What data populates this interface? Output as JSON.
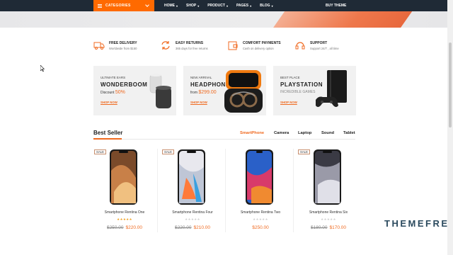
{
  "nav": {
    "categories_label": "CATEGORIES",
    "items": [
      {
        "label": "HOME"
      },
      {
        "label": "SHOP"
      },
      {
        "label": "PRODUCT"
      },
      {
        "label": "PAGES"
      },
      {
        "label": "BLOG"
      }
    ],
    "buy_label": "BUY THEME"
  },
  "hero": {
    "slides": 3,
    "active_slide": 1
  },
  "features": [
    {
      "title": "FREE DELIVERY",
      "subtitle": "Worldwide from $150",
      "icon": "truck-icon"
    },
    {
      "title": "EASY RETURNS",
      "subtitle": "365 days for free returns",
      "icon": "returns-icon"
    },
    {
      "title": "COMFORT PAYMENTS",
      "subtitle": "Cash on delivery option",
      "icon": "wallet-icon"
    },
    {
      "title": "SUPPORT",
      "subtitle": "Support 24/7 , all time",
      "icon": "headset-icon"
    }
  ],
  "banners": [
    {
      "small": "ULTIMATE EARS",
      "title": "WONDERBOOM",
      "line_prefix": "Discount ",
      "line_highlight": "50%",
      "shop": "SHOP NOW"
    },
    {
      "small": "NEW ARRIVAL",
      "title": "HEADPHONE",
      "line_prefix": "from ",
      "line_highlight": "$299.00",
      "shop": "SHOP NOW"
    },
    {
      "small": "BEST PLACE",
      "title": "PLAYSTATION",
      "line_prefix": "INCREDIBLE GAMES",
      "line_highlight": "",
      "shop": "SHOP NOW"
    }
  ],
  "best_seller": {
    "title": "Best Seller",
    "tabs": [
      {
        "label": "SmartPhone",
        "active": true
      },
      {
        "label": "Camera",
        "active": false
      },
      {
        "label": "Laptop",
        "active": false
      },
      {
        "label": "Sound",
        "active": false
      },
      {
        "label": "Tablet",
        "active": false
      }
    ]
  },
  "products": [
    {
      "name": "Smartphone Rentina One",
      "sale": "SALE",
      "rating": 5,
      "old_price": "$250.00",
      "price": "$220.00"
    },
    {
      "name": "Smartphone Rentina Four",
      "sale": "SALE",
      "rating": 0,
      "old_price": "$220.00",
      "price": "$210.00"
    },
    {
      "name": "Smartphone Rentina Two",
      "sale": "",
      "rating": 0,
      "old_price": "",
      "price": "$250.00"
    },
    {
      "name": "Smartphone Rentina Six",
      "sale": "SALE",
      "rating": 0,
      "old_price": "$180.00",
      "price": "$170.00"
    }
  ],
  "brand": "THEMEFRE",
  "colors": {
    "accent": "#f06a20",
    "nav_bg": "#1f2a36",
    "banner_bg": "#f1f1f1"
  }
}
